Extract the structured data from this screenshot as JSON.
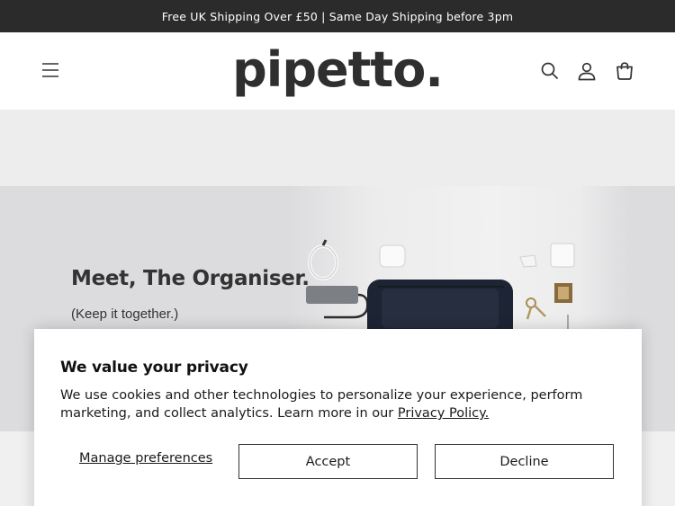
{
  "announcement": "Free UK Shipping Over £50 | Same Day Shipping before 3pm",
  "header": {
    "logo": "pipetto.",
    "icons": [
      "menu-icon",
      "search-icon",
      "account-icon",
      "cart-icon"
    ]
  },
  "hero": {
    "title": "Meet, The Organiser.",
    "subtitle": "(Keep it together.)"
  },
  "cookie_banner": {
    "title": "We value your privacy",
    "text": "We use cookies and other technologies to personalize your experience, perform marketing, and collect analytics. Learn more in our ",
    "link": "Privacy Policy.",
    "manage": "Manage preferences",
    "accept": "Accept",
    "decline": "Decline"
  }
}
